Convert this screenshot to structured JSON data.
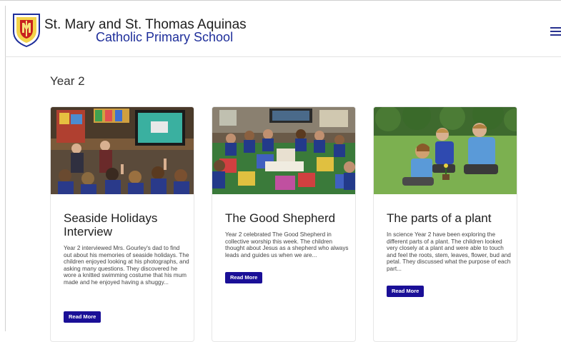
{
  "header": {
    "school_name_line1": "St. Mary and St. Thomas Aquinas",
    "school_name_line2": "Catholic Primary School",
    "crest_icon": "school-crest-icon",
    "menu_icon": "hamburger-menu-icon",
    "accent_color": "#1a0f97"
  },
  "page": {
    "title": "Year 2"
  },
  "cards": [
    {
      "title": "Seaside Holidays Interview",
      "excerpt": "Year 2 interviewed Mrs. Gourley's dad to find out about his memories of seaside holidays. The children enjoyed looking at his photographs, and asking many questions. They discovered he wore a knitted swimming costume that his mum made and he enjoyed having a shuggy...",
      "button_label": "Read More"
    },
    {
      "title": "The Good Shepherd",
      "excerpt": "Year 2 celebrated The Good Shepherd in collective worship this week. The children thought about Jesus as a shepherd who always leads and guides us when we are...",
      "button_label": "Read More"
    },
    {
      "title": "The parts of a plant",
      "excerpt": "In science Year 2 have been exploring the different parts of a plant. The children looked very closely at a plant and were able to touch and feel the roots, stem, leaves, flower, bud and petal. They discussed what the purpose of each part...",
      "button_label": "Read More"
    }
  ]
}
